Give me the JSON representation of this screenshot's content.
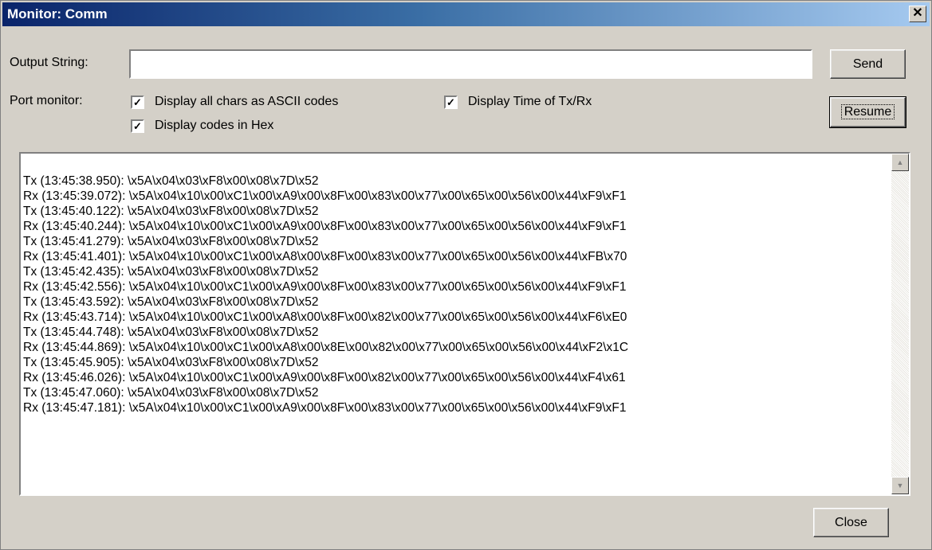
{
  "window": {
    "title": "Monitor: Comm",
    "close_glyph": "✕"
  },
  "output": {
    "label": "Output String:",
    "value": "",
    "send_label": "Send"
  },
  "port_monitor": {
    "label": "Port monitor:",
    "options": [
      {
        "label": "Display all chars as ASCII codes",
        "checked": true
      },
      {
        "label": "Display codes in Hex",
        "checked": true
      },
      {
        "label": "Display Time of Tx/Rx",
        "checked": true
      }
    ],
    "resume_label": "Resume"
  },
  "log": {
    "lines": [
      "Tx (13:45:38.950): \\x5A\\x04\\x03\\xF8\\x00\\x08\\x7D\\x52",
      "Rx (13:45:39.072): \\x5A\\x04\\x10\\x00\\xC1\\x00\\xA9\\x00\\x8F\\x00\\x83\\x00\\x77\\x00\\x65\\x00\\x56\\x00\\x44\\xF9\\xF1",
      "Tx (13:45:40.122): \\x5A\\x04\\x03\\xF8\\x00\\x08\\x7D\\x52",
      "Rx (13:45:40.244): \\x5A\\x04\\x10\\x00\\xC1\\x00\\xA9\\x00\\x8F\\x00\\x83\\x00\\x77\\x00\\x65\\x00\\x56\\x00\\x44\\xF9\\xF1",
      "Tx (13:45:41.279): \\x5A\\x04\\x03\\xF8\\x00\\x08\\x7D\\x52",
      "Rx (13:45:41.401): \\x5A\\x04\\x10\\x00\\xC1\\x00\\xA8\\x00\\x8F\\x00\\x83\\x00\\x77\\x00\\x65\\x00\\x56\\x00\\x44\\xFB\\x70",
      "Tx (13:45:42.435): \\x5A\\x04\\x03\\xF8\\x00\\x08\\x7D\\x52",
      "Rx (13:45:42.556): \\x5A\\x04\\x10\\x00\\xC1\\x00\\xA9\\x00\\x8F\\x00\\x83\\x00\\x77\\x00\\x65\\x00\\x56\\x00\\x44\\xF9\\xF1",
      "Tx (13:45:43.592): \\x5A\\x04\\x03\\xF8\\x00\\x08\\x7D\\x52",
      "Rx (13:45:43.714): \\x5A\\x04\\x10\\x00\\xC1\\x00\\xA8\\x00\\x8F\\x00\\x82\\x00\\x77\\x00\\x65\\x00\\x56\\x00\\x44\\xF6\\xE0",
      "Tx (13:45:44.748): \\x5A\\x04\\x03\\xF8\\x00\\x08\\x7D\\x52",
      "Rx (13:45:44.869): \\x5A\\x04\\x10\\x00\\xC1\\x00\\xA8\\x00\\x8E\\x00\\x82\\x00\\x77\\x00\\x65\\x00\\x56\\x00\\x44\\xF2\\x1C",
      "Tx (13:45:45.905): \\x5A\\x04\\x03\\xF8\\x00\\x08\\x7D\\x52",
      "Rx (13:45:46.026): \\x5A\\x04\\x10\\x00\\xC1\\x00\\xA9\\x00\\x8F\\x00\\x82\\x00\\x77\\x00\\x65\\x00\\x56\\x00\\x44\\xF4\\x61",
      "Tx (13:45:47.060): \\x5A\\x04\\x03\\xF8\\x00\\x08\\x7D\\x52",
      "Rx (13:45:47.181): \\x5A\\x04\\x10\\x00\\xC1\\x00\\xA9\\x00\\x8F\\x00\\x83\\x00\\x77\\x00\\x65\\x00\\x56\\x00\\x44\\xF9\\xF1"
    ]
  },
  "footer": {
    "close_label": "Close"
  }
}
